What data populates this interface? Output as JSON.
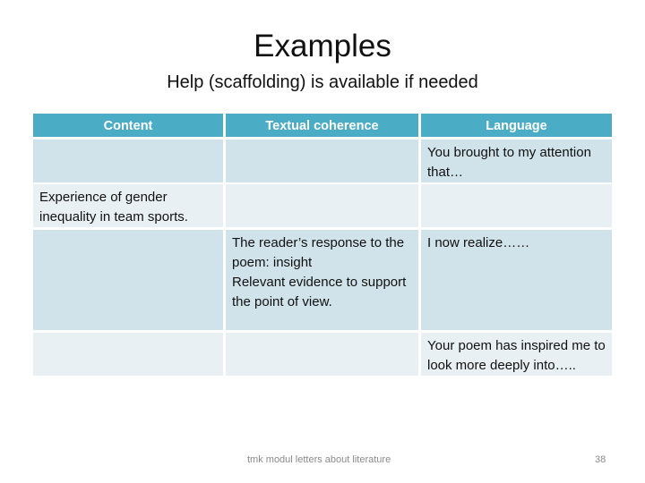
{
  "slide": {
    "title": "Examples",
    "subtitle": "Help (scaffolding) is available if needed"
  },
  "table": {
    "headers": [
      "Content",
      "Textual coherence",
      "Language"
    ],
    "rows": [
      [
        "",
        "",
        "You brought to my attention that…"
      ],
      [
        "Experience of gender inequality in team sports.",
        "",
        ""
      ],
      [
        "",
        "The reader’s response to the poem: insight\nRelevant evidence to support the point of view.",
        "I now realize……"
      ],
      [
        "",
        "",
        "Your poem has inspired me to look more deeply into….."
      ]
    ]
  },
  "footer": {
    "text": "tmk modul letters about literature",
    "page_number": "38"
  },
  "colors": {
    "header_bg": "#4bacc6",
    "row_odd_bg": "#d0e3ea",
    "row_even_bg": "#e9f0f3"
  }
}
